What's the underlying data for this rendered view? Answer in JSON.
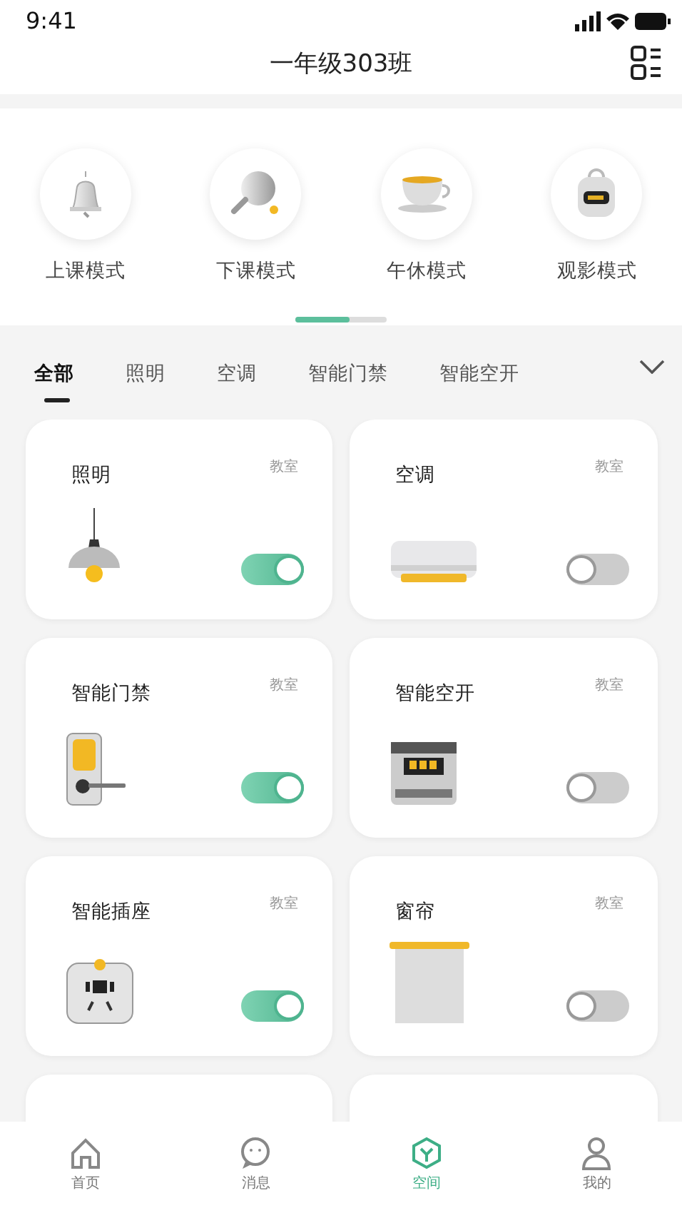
{
  "status_bar": {
    "time": "9:41"
  },
  "header": {
    "title": "一年级303班"
  },
  "modes": [
    {
      "label": "上课模式",
      "kind": "bell"
    },
    {
      "label": "下课模式",
      "kind": "paddle"
    },
    {
      "label": "午休模式",
      "kind": "cup"
    },
    {
      "label": "观影模式",
      "kind": "bag"
    }
  ],
  "categories": [
    {
      "label": "全部",
      "selected": true
    },
    {
      "label": "照明",
      "selected": false
    },
    {
      "label": "空调",
      "selected": false
    },
    {
      "label": "智能门禁",
      "selected": false
    },
    {
      "label": "智能空开",
      "selected": false
    }
  ],
  "devices": [
    {
      "name": "照明",
      "room": "教室",
      "kind": "lamp",
      "on": true
    },
    {
      "name": "空调",
      "room": "教室",
      "kind": "ac",
      "on": false
    },
    {
      "name": "智能门禁",
      "room": "教室",
      "kind": "lock",
      "on": true
    },
    {
      "name": "智能空开",
      "room": "教室",
      "kind": "breaker",
      "on": false
    },
    {
      "name": "智能插座",
      "room": "教室",
      "kind": "socket",
      "on": true
    },
    {
      "name": "窗帘",
      "room": "教室",
      "kind": "curtain",
      "on": false
    }
  ],
  "tab_bar": [
    {
      "label": "首页",
      "kind": "home",
      "selected": false
    },
    {
      "label": "消息",
      "kind": "chat",
      "selected": false
    },
    {
      "label": "空间",
      "kind": "cube",
      "selected": true
    },
    {
      "label": "我的",
      "kind": "person",
      "selected": false
    }
  ]
}
